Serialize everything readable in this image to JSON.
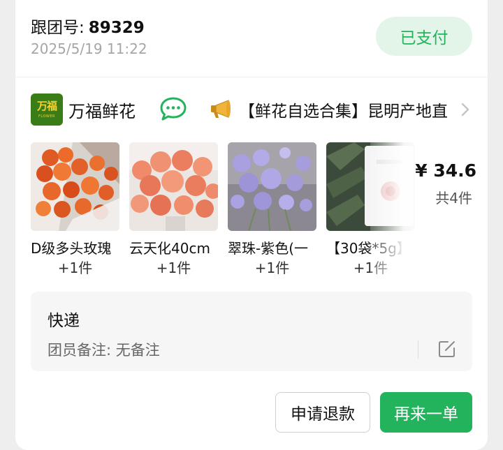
{
  "order": {
    "follow_label": "跟团号:",
    "follow_number": "89329",
    "timestamp": "2025/5/19 11:22",
    "status": "已支付"
  },
  "shop": {
    "logo_text": "万福",
    "logo_subtext": "FLOWER",
    "name": "万福鲜花",
    "announcement": "【鲜花自选合集】昆明产地直"
  },
  "products": [
    {
      "name": "D级多头玫瑰",
      "qty": "+1件"
    },
    {
      "name": "云天化40cm",
      "qty": "+1件"
    },
    {
      "name": "翠珠-紫色(一",
      "qty": "+1件"
    },
    {
      "name": "【30袋*5g】",
      "qty": "+1件"
    }
  ],
  "summary": {
    "price": "¥ 34.6",
    "count": "共4件"
  },
  "delivery": {
    "method": "快递",
    "remark": "团员备注: 无备注"
  },
  "actions": {
    "refund": "申请退款",
    "reorder": "再来一单"
  },
  "colors": {
    "accent": "#23b35d",
    "badge_bg": "#e3f5e9",
    "logo_bg": "#3a7d18"
  },
  "icons": [
    "chat-bubble-icon",
    "megaphone-icon",
    "chevron-right-icon",
    "edit-icon"
  ]
}
